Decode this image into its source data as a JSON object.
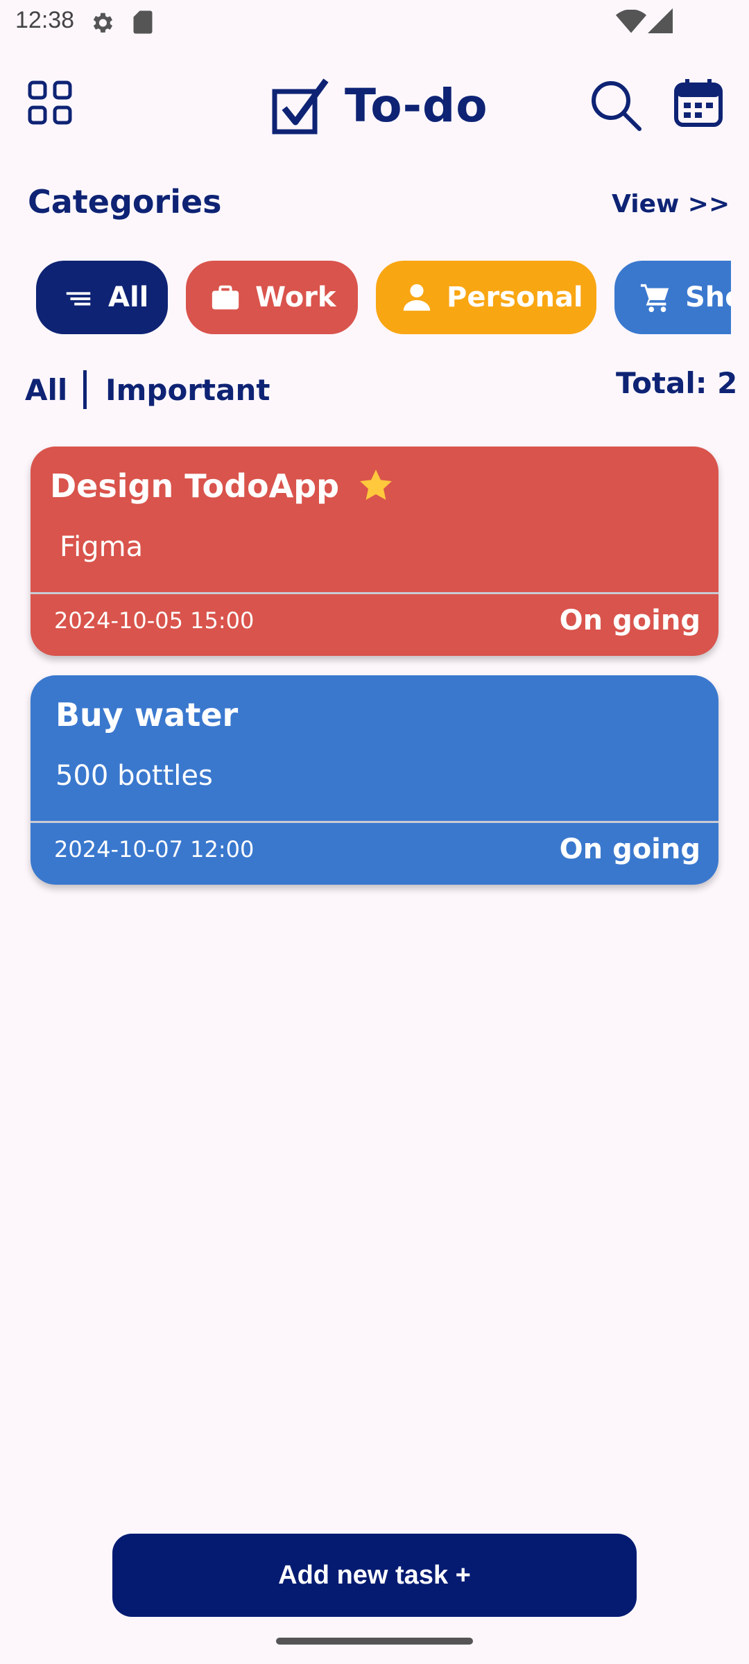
{
  "status_bar": {
    "time": "12:38",
    "icons": [
      "gear-icon",
      "sd-card-icon",
      "wifi-icon",
      "cell-signal-icon"
    ]
  },
  "header": {
    "title": "To-do",
    "icons": [
      "grid-menu-icon",
      "checkbox-logo-icon",
      "search-icon",
      "calendar-icon"
    ]
  },
  "categories": {
    "title": "Categories",
    "view_link": "View >>",
    "chips": [
      {
        "label": "All",
        "icon": "list-icon",
        "color": "#0E2374"
      },
      {
        "label": "Work",
        "icon": "briefcase-icon",
        "color": "#D9544C"
      },
      {
        "label": "Personal",
        "icon": "person-icon",
        "color": "#F9A613"
      },
      {
        "label": "Shopping",
        "icon": "cart-icon",
        "color": "#3A78CE"
      }
    ]
  },
  "filters": {
    "all": "All",
    "important": "Important",
    "total": "Total: 2"
  },
  "tasks": [
    {
      "title": "Design TodoApp",
      "important": true,
      "description": "Figma",
      "datetime": "2024-10-05 15:00",
      "status": "On going",
      "color": "#D9544C"
    },
    {
      "title": "Buy water",
      "important": false,
      "description": "500 bottles",
      "datetime": "2024-10-07 12:00",
      "status": "On going",
      "color": "#3A78CE"
    }
  ],
  "add_button": {
    "label": "Add new task +"
  },
  "colors": {
    "primary": "#0E2374",
    "background": "#FDF7FC",
    "button": "#051B72"
  }
}
